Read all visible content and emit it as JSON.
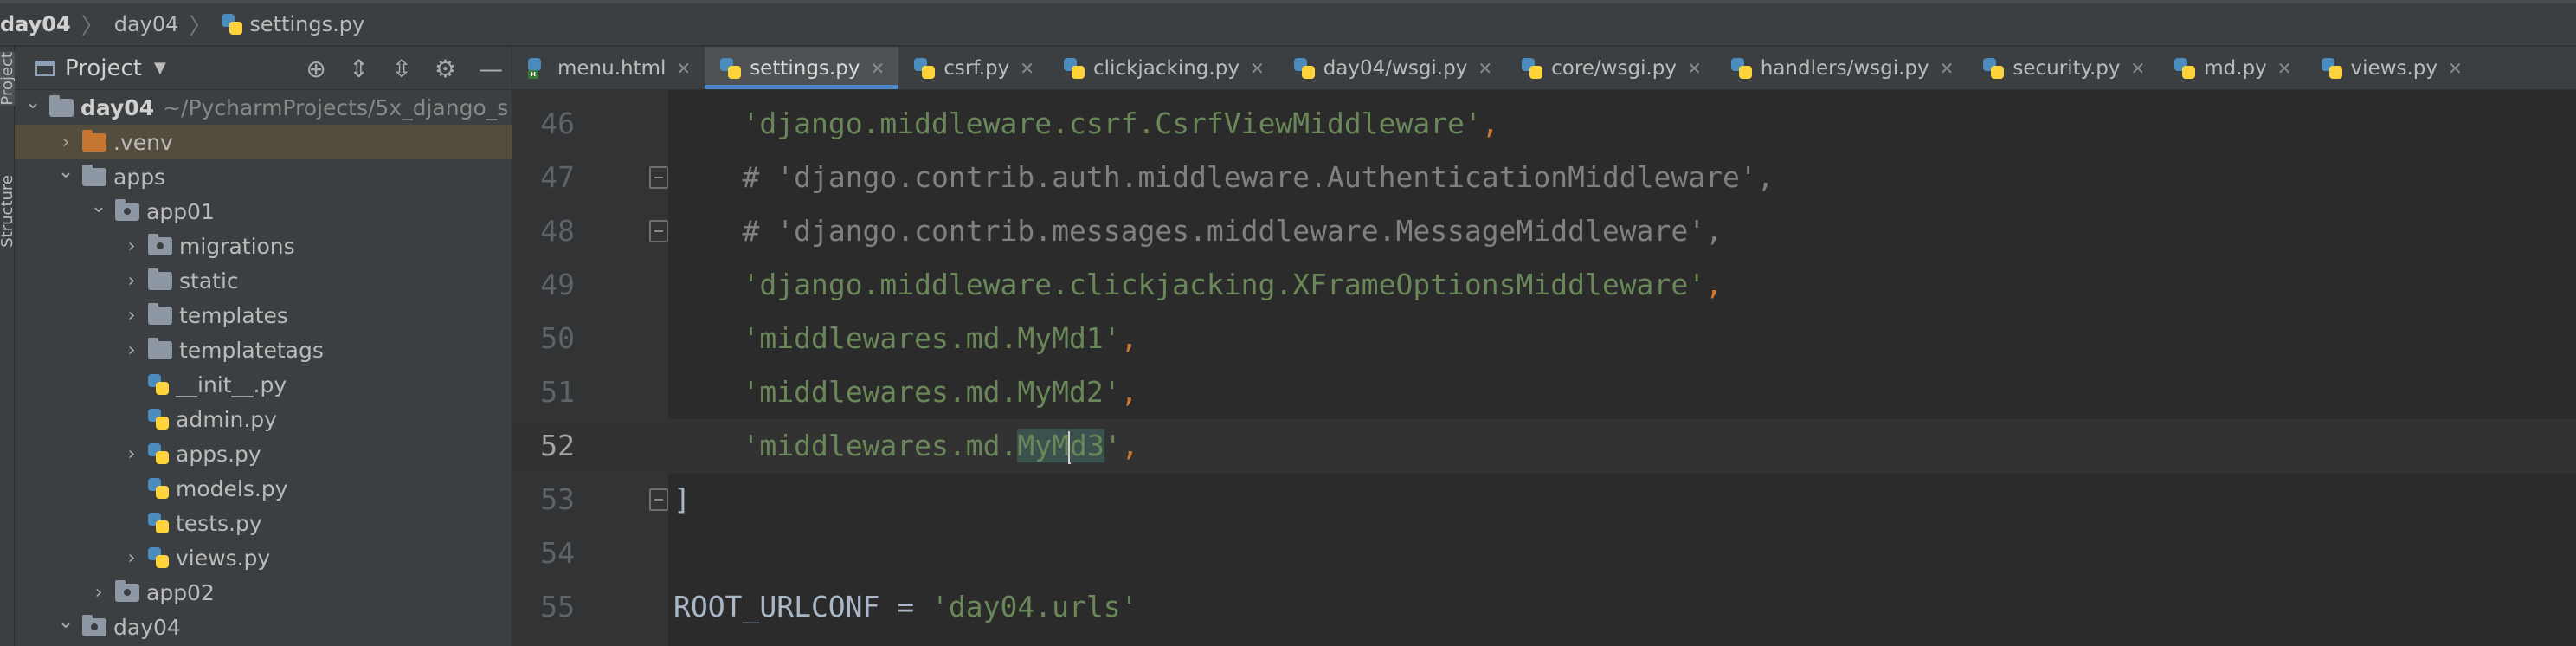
{
  "breadcrumb": {
    "items": [
      "day04",
      "day04",
      "settings.py"
    ]
  },
  "toolstrip": {
    "tabs": [
      "Project",
      "Structure"
    ]
  },
  "project": {
    "title": "Project",
    "tree": [
      {
        "label": "day04",
        "suffix": "~/PycharmProjects/5x_django_s",
        "icon": "folder-icon",
        "arrow": "expanded",
        "depth": 0
      },
      {
        "label": ".venv",
        "icon": "folder-orange-icon",
        "arrow": "collapsed",
        "depth": 1,
        "selected": true
      },
      {
        "label": "apps",
        "icon": "folder-icon",
        "arrow": "expanded",
        "depth": 1
      },
      {
        "label": "app01",
        "icon": "package-folder-icon",
        "arrow": "expanded",
        "depth": 2
      },
      {
        "label": "migrations",
        "icon": "package-folder-icon",
        "arrow": "collapsed",
        "depth": 3
      },
      {
        "label": "static",
        "icon": "folder-icon",
        "arrow": "collapsed",
        "depth": 3
      },
      {
        "label": "templates",
        "icon": "folder-icon",
        "arrow": "collapsed",
        "depth": 3
      },
      {
        "label": "templatetags",
        "icon": "folder-icon",
        "arrow": "collapsed",
        "depth": 3
      },
      {
        "label": "__init__.py",
        "icon": "python-file-icon",
        "arrow": "none",
        "depth": 3
      },
      {
        "label": "admin.py",
        "icon": "python-file-icon",
        "arrow": "none",
        "depth": 3
      },
      {
        "label": "apps.py",
        "icon": "python-file-icon",
        "arrow": "collapsed",
        "depth": 3
      },
      {
        "label": "models.py",
        "icon": "python-file-icon",
        "arrow": "none",
        "depth": 3
      },
      {
        "label": "tests.py",
        "icon": "python-file-icon",
        "arrow": "none",
        "depth": 3
      },
      {
        "label": "views.py",
        "icon": "python-file-icon",
        "arrow": "collapsed",
        "depth": 3
      },
      {
        "label": "app02",
        "icon": "package-folder-icon",
        "arrow": "collapsed",
        "depth": 2
      },
      {
        "label": "day04",
        "icon": "package-folder-icon",
        "arrow": "expanded",
        "depth": 1
      }
    ]
  },
  "tabs": [
    {
      "label": "menu.html",
      "icon": "html-file-icon",
      "active": false
    },
    {
      "label": "settings.py",
      "icon": "python-file-icon",
      "active": true
    },
    {
      "label": "csrf.py",
      "icon": "python-file-icon",
      "active": false
    },
    {
      "label": "clickjacking.py",
      "icon": "python-file-icon",
      "active": false
    },
    {
      "label": "day04/wsgi.py",
      "icon": "python-file-icon",
      "active": false
    },
    {
      "label": "core/wsgi.py",
      "icon": "python-file-icon",
      "active": false
    },
    {
      "label": "handlers/wsgi.py",
      "icon": "python-file-icon",
      "active": false
    },
    {
      "label": "security.py",
      "icon": "python-file-icon",
      "active": false
    },
    {
      "label": "md.py",
      "icon": "python-file-icon",
      "active": false
    },
    {
      "label": "views.py",
      "icon": "python-file-icon",
      "active": false
    }
  ],
  "editor": {
    "current_line": 52,
    "lines": [
      {
        "n": 46,
        "indent": "    ",
        "string": "'django.middleware.csrf.CsrfViewMiddleware'",
        "after": ","
      },
      {
        "n": 47,
        "indent": "    ",
        "comment": "# 'django.contrib.auth.middleware.AuthenticationMiddleware',",
        "fold": true
      },
      {
        "n": 48,
        "indent": "    ",
        "comment": "# 'django.contrib.messages.middleware.MessageMiddleware',",
        "fold": true
      },
      {
        "n": 49,
        "indent": "    ",
        "string": "'django.middleware.clickjacking.XFrameOptionsMiddleware'",
        "after": ","
      },
      {
        "n": 50,
        "indent": "    ",
        "string": "'middlewares.md.MyMd1'",
        "after": ","
      },
      {
        "n": 51,
        "indent": "    ",
        "string": "'middlewares.md.MyMd2'",
        "after": ","
      },
      {
        "n": 52,
        "indent": "    ",
        "string_pre": "'middlewares.md.",
        "hl_a": "MyM",
        "hl_b": "d3",
        "string_post": "'",
        "after": ","
      },
      {
        "n": 53,
        "text": "]",
        "fold": true
      },
      {
        "n": 54,
        "text": ""
      },
      {
        "n": 55,
        "name": "ROOT_URLCONF",
        "eq": " = ",
        "string": "'day04.urls'"
      }
    ]
  },
  "colors": {
    "accent": "#4a88c7",
    "string": "#6a8759",
    "comment": "#808080",
    "keyword": "#cc7832"
  }
}
